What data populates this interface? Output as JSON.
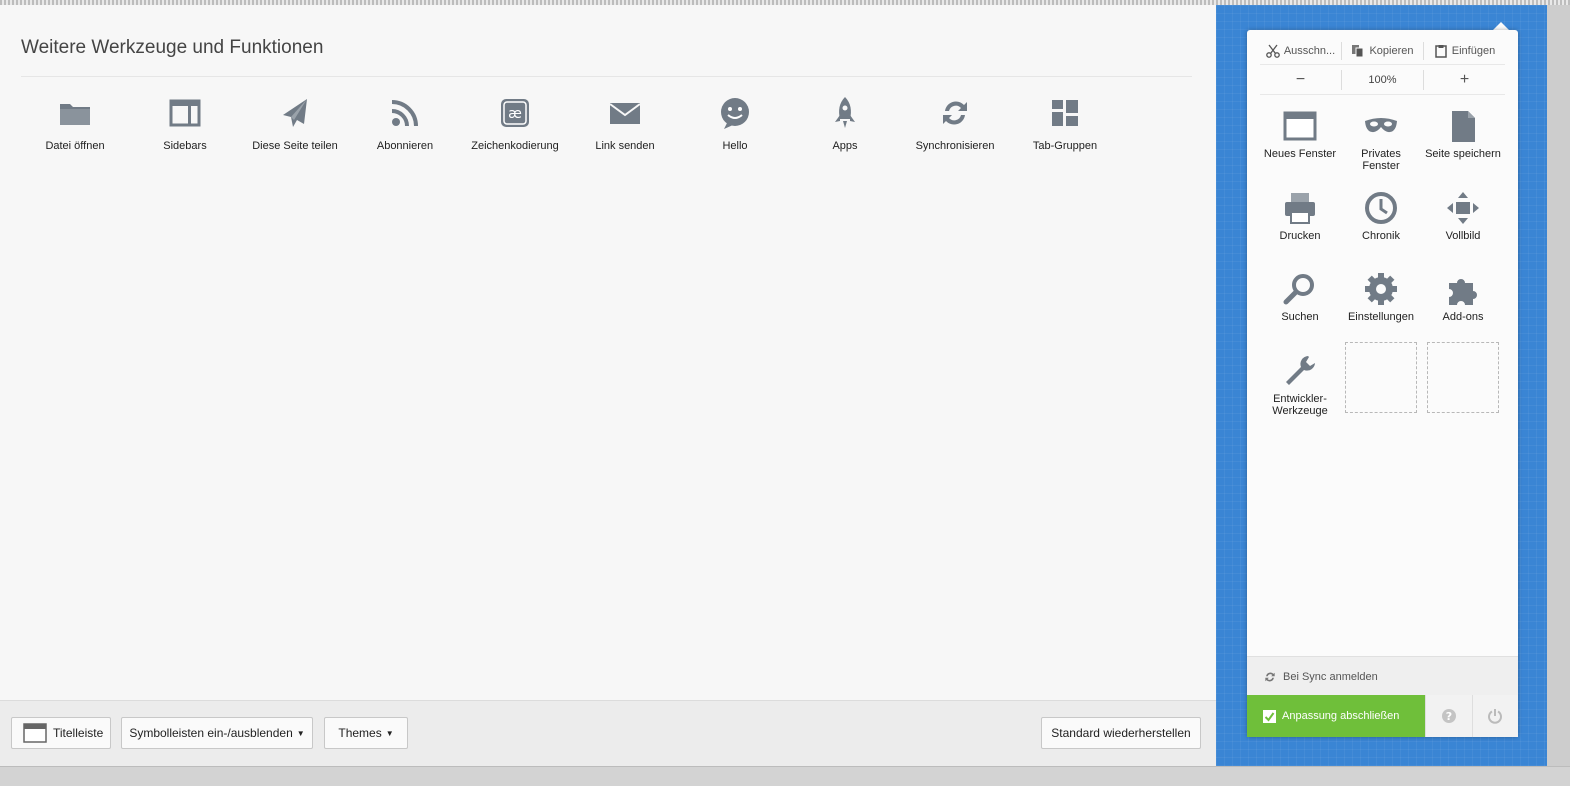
{
  "main": {
    "title": "Weitere Werkzeuge und Funktionen",
    "palette": [
      {
        "label": "Datei öffnen",
        "icon": "folder-icon"
      },
      {
        "label": "Sidebars",
        "icon": "sidebar-icon"
      },
      {
        "label": "Diese Seite teilen",
        "icon": "paper-plane-icon"
      },
      {
        "label": "Abonnieren",
        "icon": "rss-icon"
      },
      {
        "label": "Zeichenkodierung",
        "icon": "character-encoding-icon"
      },
      {
        "label": "Link senden",
        "icon": "envelope-icon"
      },
      {
        "label": "Hello",
        "icon": "chat-bubble-icon"
      },
      {
        "label": "Apps",
        "icon": "rocket-icon"
      },
      {
        "label": "Synchronisieren",
        "icon": "sync-icon"
      },
      {
        "label": "Tab-Gruppen",
        "icon": "tab-groups-icon"
      }
    ]
  },
  "toolbar": {
    "titlebar_label": "Titelleiste",
    "toolbars_label": "Symbolleisten ein-/ausblenden",
    "themes_label": "Themes",
    "restore_label": "Standard wiederherstellen"
  },
  "panel": {
    "edit": {
      "cut": "Ausschn...",
      "copy": "Kopieren",
      "paste": "Einfügen"
    },
    "zoom": {
      "minus": "−",
      "level": "100%",
      "plus": "+"
    },
    "items": [
      {
        "label": "Neues Fenster",
        "icon": "window-icon"
      },
      {
        "label": "Privates Fenster",
        "icon": "mask-icon"
      },
      {
        "label": "Seite speichern",
        "icon": "page-icon"
      },
      {
        "label": "Drucken",
        "icon": "printer-icon"
      },
      {
        "label": "Chronik",
        "icon": "clock-icon"
      },
      {
        "label": "Vollbild",
        "icon": "fullscreen-icon"
      },
      {
        "label": "Suchen",
        "icon": "search-icon"
      },
      {
        "label": "Einstellungen",
        "icon": "gear-icon"
      },
      {
        "label": "Add-ons",
        "icon": "puzzle-icon"
      },
      {
        "label": "Entwickler-Werkzeuge",
        "icon": "wrench-icon"
      }
    ],
    "sync_label": "Bei Sync anmelden",
    "done_label": "Anpassung abschließen"
  },
  "colors": {
    "accent_blue": "#3a85d4",
    "done_green": "#6fbf3a",
    "icon_gray": "#717b86"
  }
}
